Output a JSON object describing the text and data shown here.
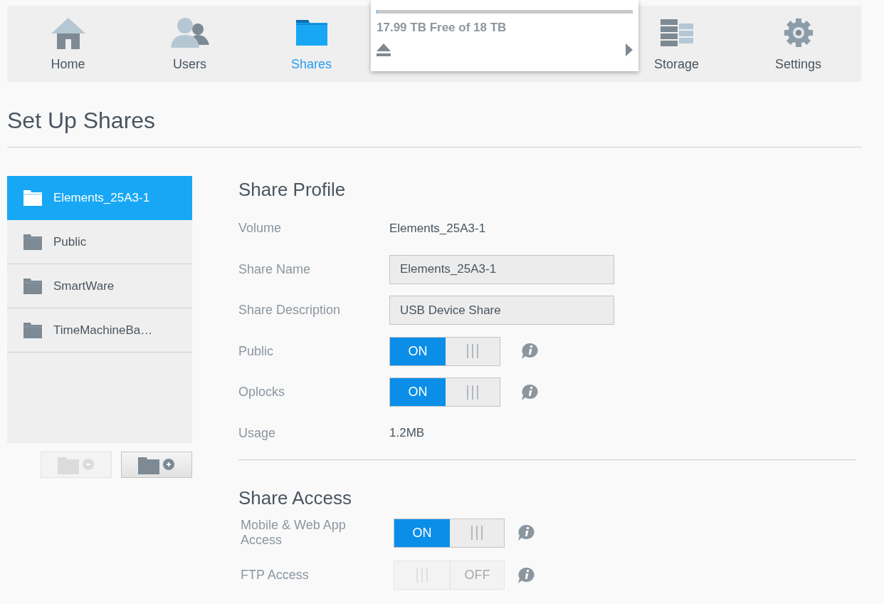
{
  "nav": {
    "items": [
      {
        "label": "Home",
        "selected": false
      },
      {
        "label": "Users",
        "selected": false
      },
      {
        "label": "Shares",
        "selected": true
      },
      {
        "label": "Storage",
        "selected": false
      },
      {
        "label": "Settings",
        "selected": false
      }
    ]
  },
  "device_popup": {
    "free_text": "17.99 TB Free of 18 TB",
    "level": 0.0006
  },
  "page_title": "Set Up Shares",
  "shares": [
    {
      "name": "Elements_25A3-1",
      "selected": true
    },
    {
      "name": "Public",
      "selected": false
    },
    {
      "name": "SmartWare",
      "selected": false
    },
    {
      "name": "TimeMachineBa…",
      "selected": false
    }
  ],
  "share_buttons": [
    {
      "kind": "remove",
      "disabled": true
    },
    {
      "kind": "add",
      "disabled": false
    }
  ],
  "profile": {
    "title": "Share Profile",
    "rows": [
      {
        "kind": "text",
        "label": "Volume",
        "value": "Elements_25A3-1"
      },
      {
        "kind": "field",
        "label": "Share Name",
        "value": "Elements_25A3-1"
      },
      {
        "kind": "field",
        "label": "Share Description",
        "value": "USB Device Share"
      },
      {
        "kind": "toggle",
        "label": "Public",
        "on": true,
        "on_text": "ON"
      },
      {
        "kind": "toggle",
        "label": "Oplocks",
        "on": true,
        "on_text": "ON"
      },
      {
        "kind": "text",
        "label": "Usage",
        "value": "1.2MB"
      }
    ]
  },
  "access": {
    "title": "Share Access",
    "rows": [
      {
        "kind": "toggle",
        "label": "Mobile & Web App Access",
        "on": true,
        "on_text": "ON"
      },
      {
        "kind": "toggle",
        "label": "FTP Access",
        "on": false,
        "off_text": "OFF"
      }
    ]
  }
}
